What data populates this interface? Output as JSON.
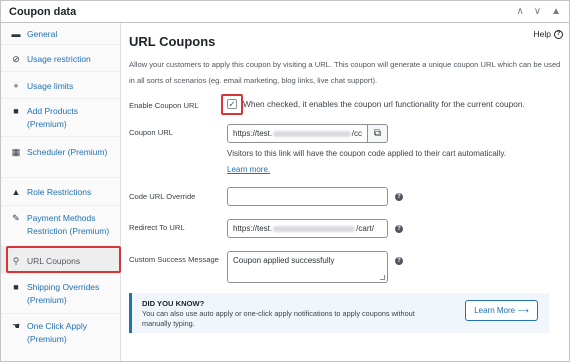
{
  "panel": {
    "title": "Coupon data",
    "arrow_up": "∧",
    "arrow_down": "∨",
    "arrow_collapse": "▲"
  },
  "sidebar": {
    "items": [
      {
        "label": "General",
        "icon": "ticket-icon",
        "glyph": "▬"
      },
      {
        "label": "Usage restriction",
        "icon": "ban-icon",
        "glyph": "⊘"
      },
      {
        "label": "Usage limits",
        "icon": "plus-icon",
        "glyph": "+"
      },
      {
        "label": "Add Products (Premium)",
        "icon": "bag-icon",
        "glyph": "■"
      },
      {
        "label": "Scheduler (Premium)",
        "icon": "calendar-icon",
        "glyph": "▦"
      },
      {
        "label": "Role Restrictions",
        "icon": "user-icon",
        "glyph": "▲"
      },
      {
        "label": "Payment Methods Restriction (Premium)",
        "icon": "wrench-icon",
        "glyph": "✎"
      },
      {
        "label": "URL Coupons",
        "icon": "link-icon",
        "glyph": "⚲"
      },
      {
        "label": "Shipping Overrides (Premium)",
        "icon": "truck-icon",
        "glyph": "■"
      },
      {
        "label": "One Click Apply (Premium)",
        "icon": "pointer-icon",
        "glyph": "☚"
      }
    ],
    "active": "URL Coupons"
  },
  "main": {
    "help": "Help",
    "help_icon": "?",
    "title": "URL Coupons",
    "description": "Allow your customers to apply this coupon by visiting a URL. This coupon will generate a unique coupon URL which can be used in all sorts of scenarios (eg. email marketing, blog links, live chat support).",
    "enable": {
      "label": "Enable Coupon URL",
      "checked_mark": "✓",
      "text": "When checked, it enables the coupon url functionality for the current coupon."
    },
    "coupon_url": {
      "label": "Coupon URL",
      "value_prefix": "https://test.",
      "value_suffix": "/cc",
      "copy_icon": "⧉",
      "hint": "Visitors to this link will have the coupon code applied to their cart automatically.",
      "learn_more": "Learn more."
    },
    "code_override": {
      "label": "Code URL Override",
      "value": ""
    },
    "redirect": {
      "label": "Redirect To URL",
      "value_prefix": "https://test.",
      "value_suffix": "/cart/"
    },
    "success_message": {
      "label": "Custom Success Message",
      "value": "Coupon applied successfully"
    },
    "tip_icon": "?",
    "notice": {
      "title": "DID YOU KNOW?",
      "text": "You can also use auto apply or one-click apply notifications to apply coupons without manually typing.",
      "button": "Learn More ⟶"
    }
  },
  "colors": {
    "accent": "#2271b1",
    "highlight": "#d63638"
  }
}
